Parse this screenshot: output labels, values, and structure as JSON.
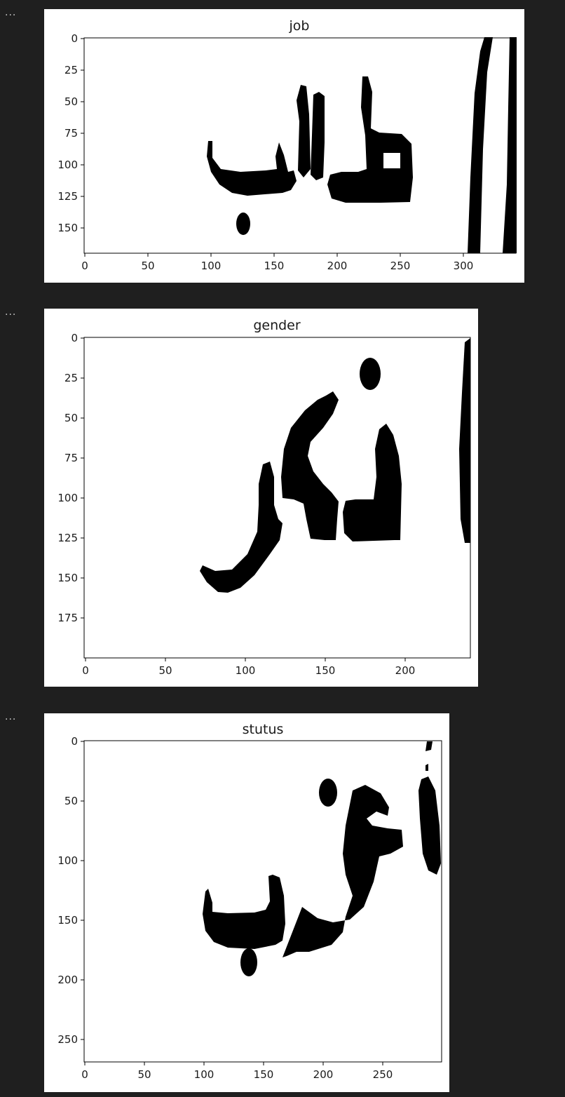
{
  "cells": [
    {
      "output_menu_label": "...",
      "title": "job",
      "x_ticks": [
        "0",
        "50",
        "100",
        "150",
        "200",
        "250",
        "300"
      ],
      "y_ticks": [
        "0",
        "25",
        "50",
        "75",
        "100",
        "125",
        "150"
      ],
      "image_content": "binarized Arabic handwritten word"
    },
    {
      "output_menu_label": "...",
      "title": "gender",
      "x_ticks": [
        "0",
        "50",
        "100",
        "150",
        "200"
      ],
      "y_ticks": [
        "0",
        "25",
        "50",
        "75",
        "100",
        "125",
        "150",
        "175"
      ],
      "image_content": "binarized Arabic handwritten word"
    },
    {
      "output_menu_label": "...",
      "title": "stutus",
      "x_ticks": [
        "0",
        "50",
        "100",
        "150",
        "200",
        "250"
      ],
      "y_ticks": [
        "0",
        "50",
        "100",
        "150",
        "200",
        "250"
      ],
      "image_content": "binarized Arabic handwritten word"
    }
  ],
  "chart_data": [
    {
      "type": "image",
      "title": "job",
      "xlim": [
        -0.5,
        342.5
      ],
      "ylim": [
        170.5,
        -0.5
      ],
      "x_ticks": [
        0,
        50,
        100,
        150,
        200,
        250,
        300
      ],
      "y_ticks": [
        0,
        25,
        50,
        75,
        100,
        125,
        150
      ]
    },
    {
      "type": "image",
      "title": "gender",
      "xlim": [
        -0.5,
        240.5
      ],
      "ylim": [
        199.5,
        -0.5
      ],
      "x_ticks": [
        0,
        50,
        100,
        150,
        200
      ],
      "y_ticks": [
        0,
        25,
        50,
        75,
        100,
        125,
        150,
        175
      ]
    },
    {
      "type": "image",
      "title": "stutus",
      "xlim": [
        -0.5,
        299.5
      ],
      "ylim": [
        270.5,
        -0.5
      ],
      "x_ticks": [
        0,
        50,
        100,
        150,
        200,
        250
      ],
      "y_ticks": [
        0,
        50,
        100,
        150,
        200,
        250
      ]
    }
  ]
}
